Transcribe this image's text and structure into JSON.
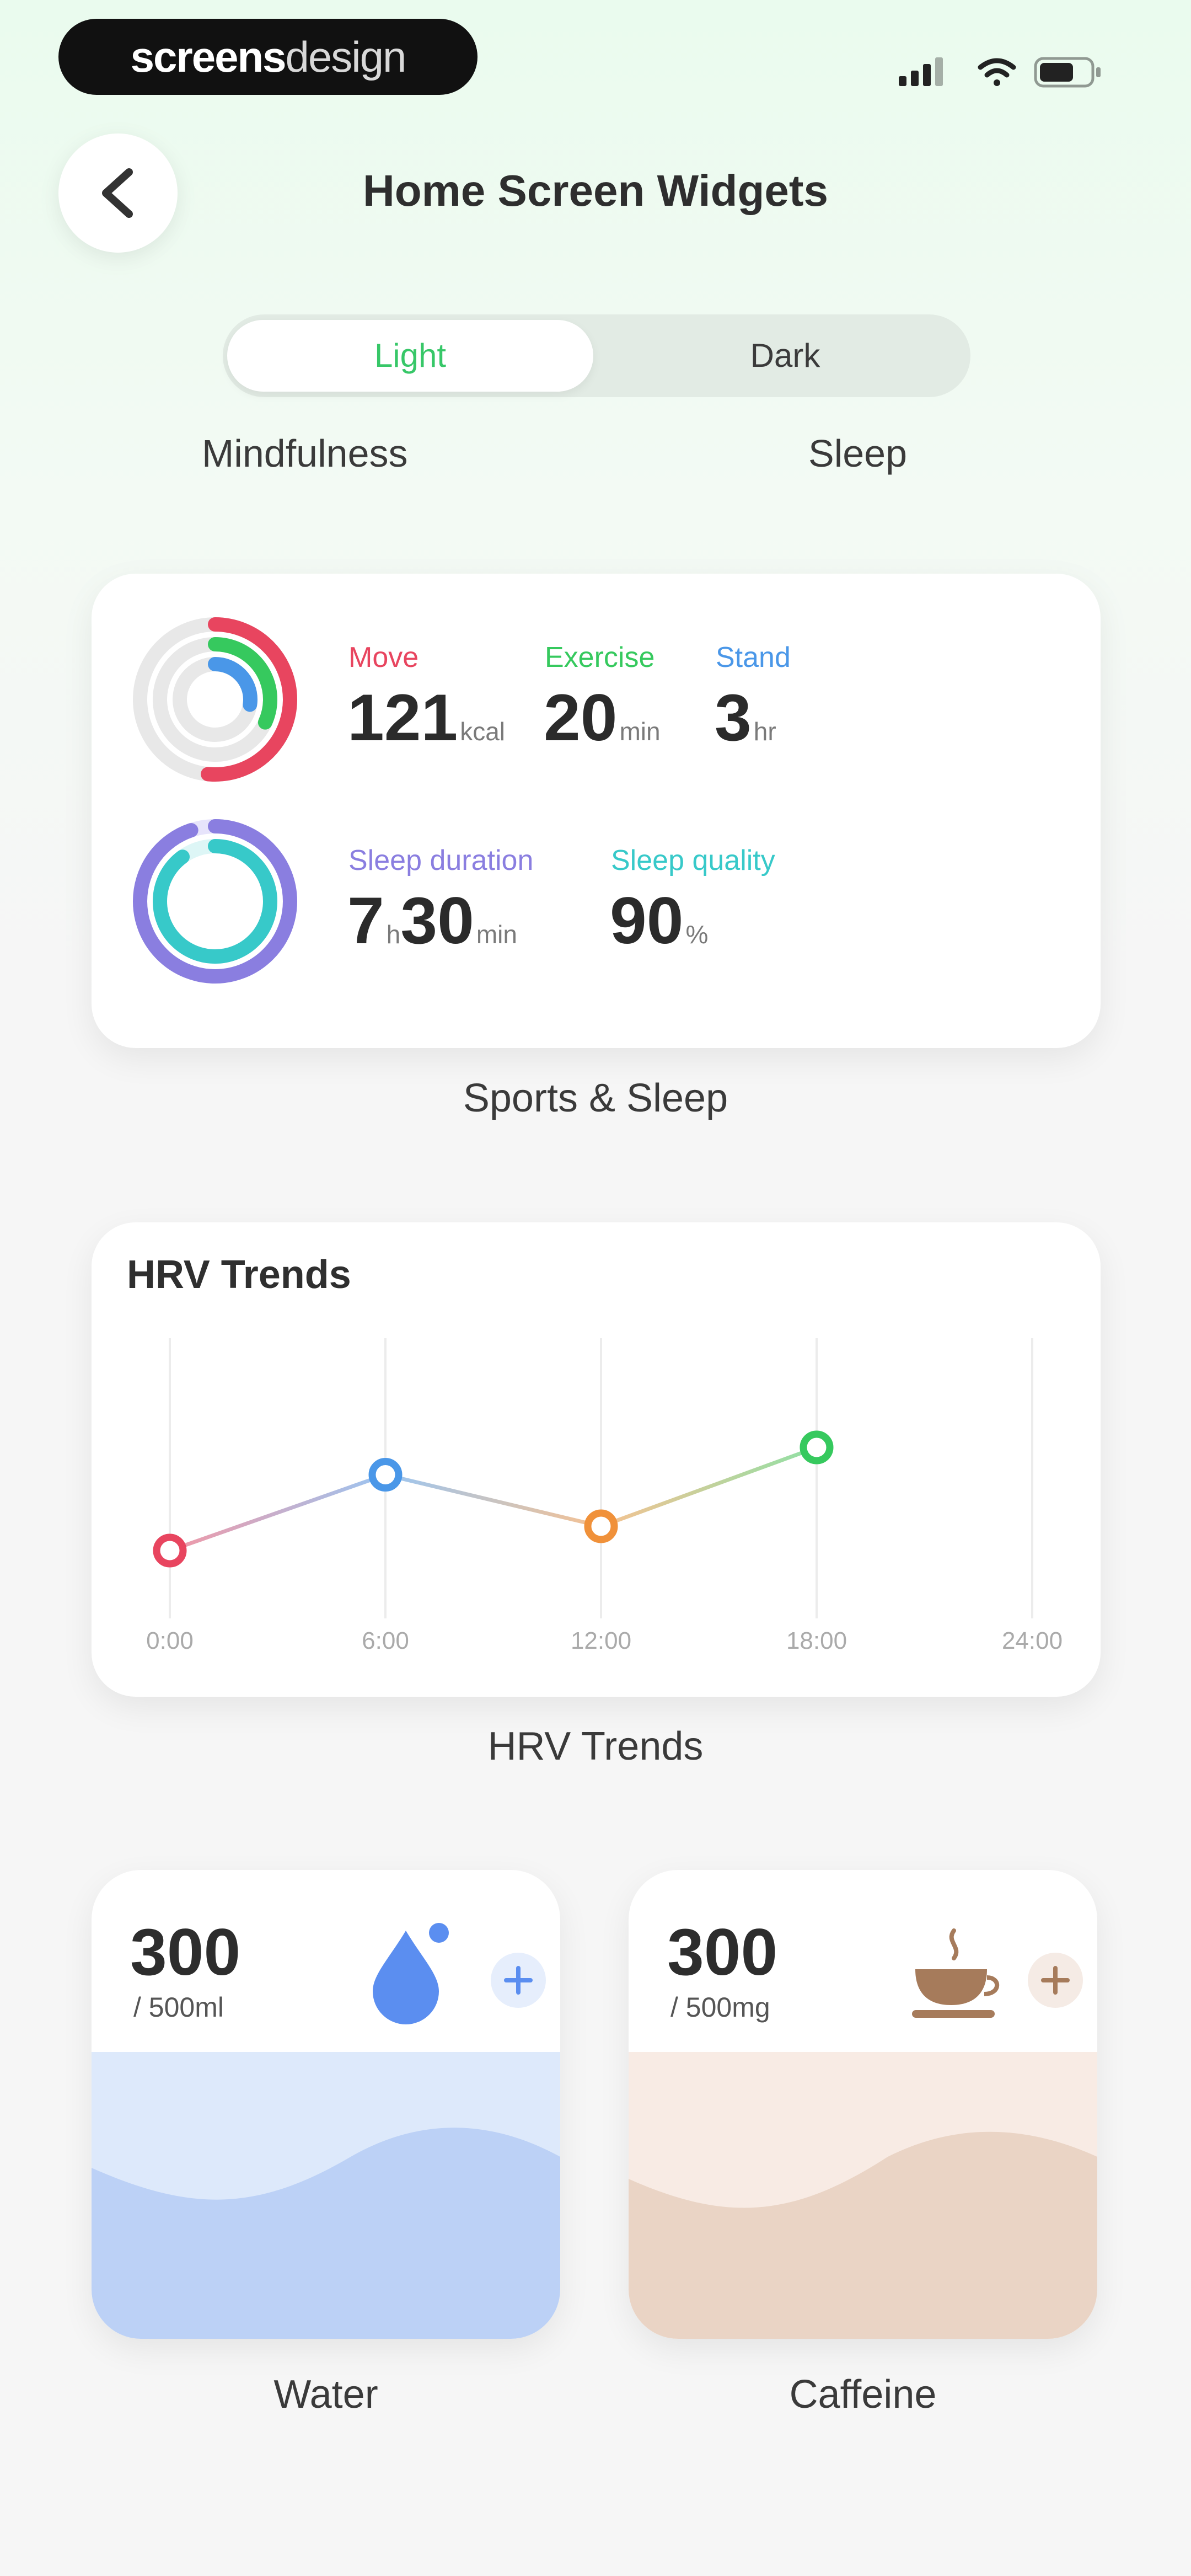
{
  "status_bar": {
    "brand_part1": "screens",
    "brand_part2": "design",
    "icons": [
      "signal-icon",
      "wifi-icon",
      "battery-icon"
    ]
  },
  "header": {
    "title": "Home Screen Widgets",
    "back_icon": "chevron-left-icon"
  },
  "theme_toggle": {
    "options": [
      "Light",
      "Dark"
    ],
    "selected": "Light"
  },
  "categories": {
    "left": "Mindfulness",
    "right": "Sleep"
  },
  "sports_sleep_widget": {
    "caption": "Sports & Sleep",
    "activity": [
      {
        "label": "Move",
        "value": "121",
        "unit": "kcal",
        "color": "#e8455f"
      },
      {
        "label": "Exercise",
        "value": "20",
        "unit": "min",
        "color": "#36c95e"
      },
      {
        "label": "Stand",
        "value": "3",
        "unit": "hr",
        "color": "#4a97e8"
      }
    ],
    "sleep": [
      {
        "label": "Sleep duration",
        "value_h": "7",
        "h_unit": "h",
        "value_m": "30",
        "m_unit": "min",
        "color": "#8a7ee0"
      },
      {
        "label": "Sleep quality",
        "value": "90",
        "unit": "%",
        "color": "#37c9c9"
      }
    ]
  },
  "hrv_widget": {
    "title": "HRV Trends",
    "caption": "HRV Trends",
    "chart_data": {
      "type": "line",
      "title": "HRV Trends",
      "categories": [
        "0:00",
        "6:00",
        "12:00",
        "18:00",
        "24:00"
      ],
      "series": [
        {
          "values": [
            30,
            55,
            38,
            64
          ]
        }
      ],
      "point_colors": [
        "#e8455f",
        "#4a97e8",
        "#f0913a",
        "#36c95e"
      ],
      "ylim": [
        0,
        100
      ],
      "grid": "vertical"
    }
  },
  "water_widget": {
    "amount": "300",
    "goal": "/ 500ml",
    "caption": "Water",
    "icon": "water-drop-icon",
    "add_icon": "plus-icon",
    "fill_fraction": 0.6,
    "accent": "#5b8ef0"
  },
  "caffeine_widget": {
    "amount": "300",
    "goal": "/ 500mg",
    "caption": "Caffeine",
    "icon": "coffee-cup-icon",
    "add_icon": "plus-icon",
    "fill_fraction": 0.6,
    "accent": "#a67b5b"
  }
}
